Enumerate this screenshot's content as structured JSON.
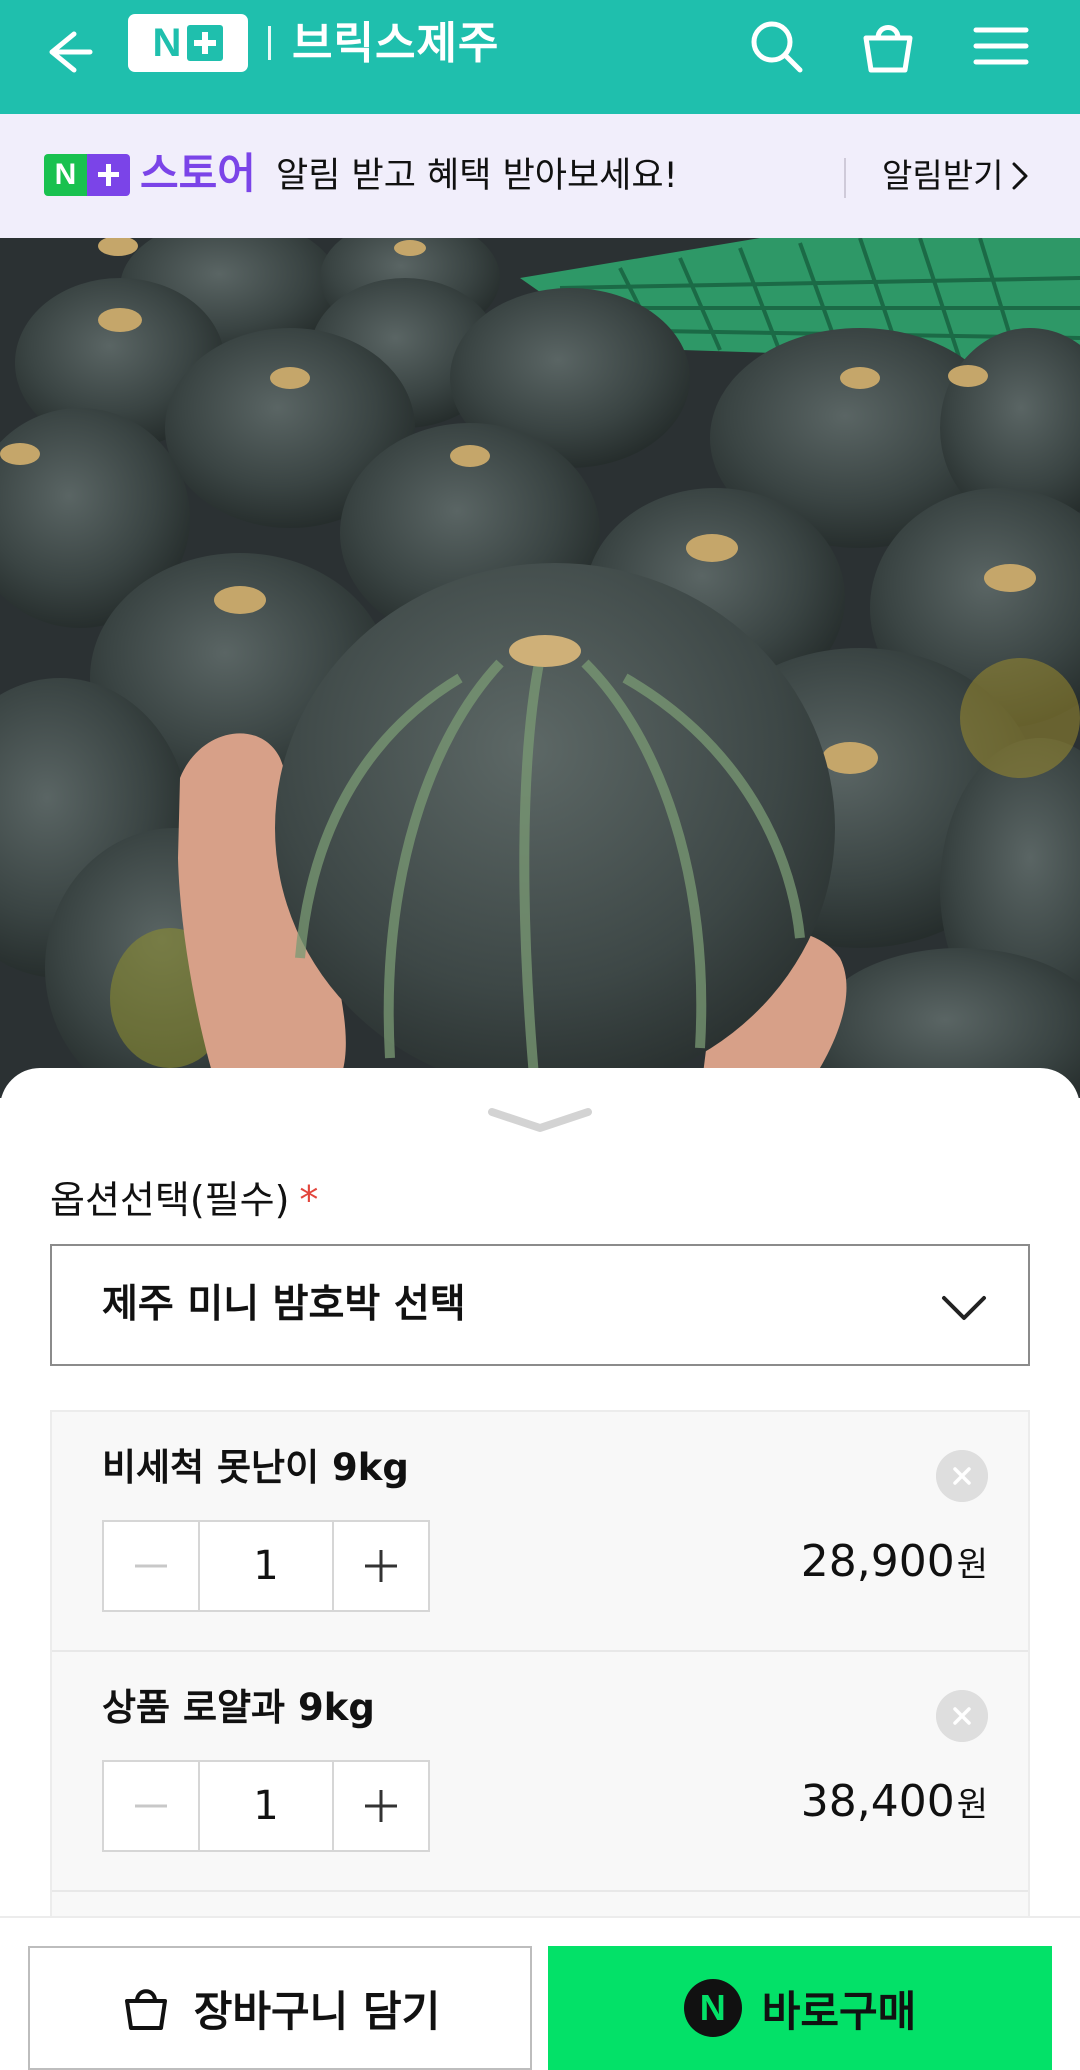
{
  "header": {
    "logo_letter": "N",
    "store_name": "브릭스제주",
    "bg_color": "#1fbfad",
    "icons": [
      "back-arrow-icon",
      "search-icon",
      "shopping-bag-icon",
      "hamburger-menu-icon"
    ]
  },
  "banner": {
    "badge_letter": "N",
    "store_label": "스토어",
    "message": "알림 받고 혜택 받아보세요!",
    "link_label": "알림받기"
  },
  "option": {
    "label": "옵션선택(필수)",
    "required_mark": "*",
    "select_value": "제주 미니 밤호박 선택"
  },
  "items": [
    {
      "name": "비세척 못난이 9kg",
      "quantity": "1",
      "price": "28,900",
      "currency": "원"
    },
    {
      "name": "상품 로얄과 9kg",
      "quantity": "1",
      "price": "38,400",
      "currency": "원"
    }
  ],
  "bottom_bar": {
    "cart_label": "장바구니 담기",
    "buy_badge": "N",
    "buy_label": "바로구매",
    "buy_color": "#03e168"
  }
}
